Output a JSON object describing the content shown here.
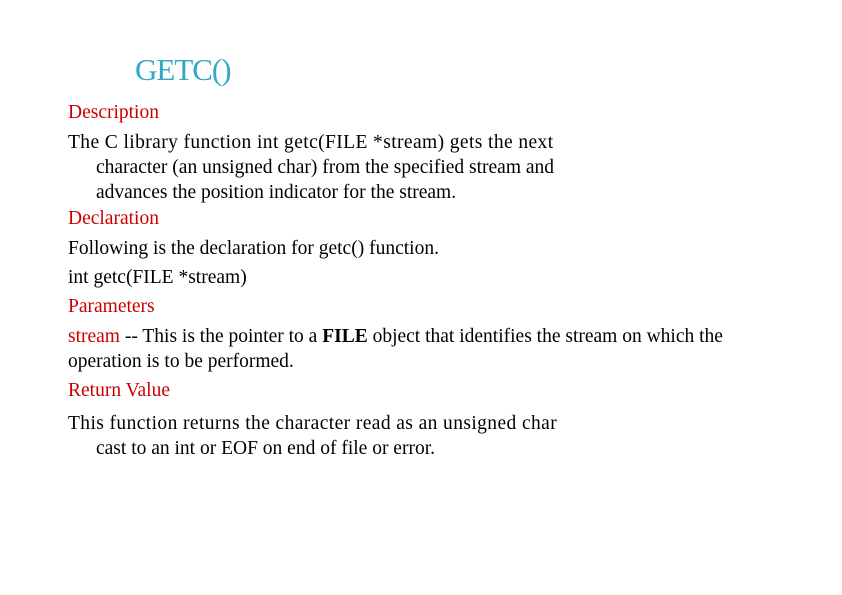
{
  "slide": {
    "title": "GETC()",
    "sections": {
      "description_heading": "Description",
      "description_text_line1": "The C library function int getc(FILE *stream) gets the next",
      "description_text_line2": "character (an unsigned char) from the specified stream and",
      "description_text_line3": "advances the position indicator for the stream.",
      "declaration_heading": "Declaration",
      "declaration_text": "Following is the declaration for getc() function.",
      "declaration_code": " int getc(FILE *stream)",
      "parameters_heading": "Parameters",
      "parameter_name": "stream",
      "parameter_desc_part1": " -- This is the pointer to a ",
      "parameter_desc_bold": "FILE",
      "parameter_desc_part2": " object that identifies the",
      "parameter_desc_line2": "stream on which the operation is to be performed.",
      "return_heading": "Return Value",
      "return_text_line1": "This function returns the character read as an unsigned char",
      "return_text_line2": "cast to an int or EOF on end of file or error."
    }
  }
}
